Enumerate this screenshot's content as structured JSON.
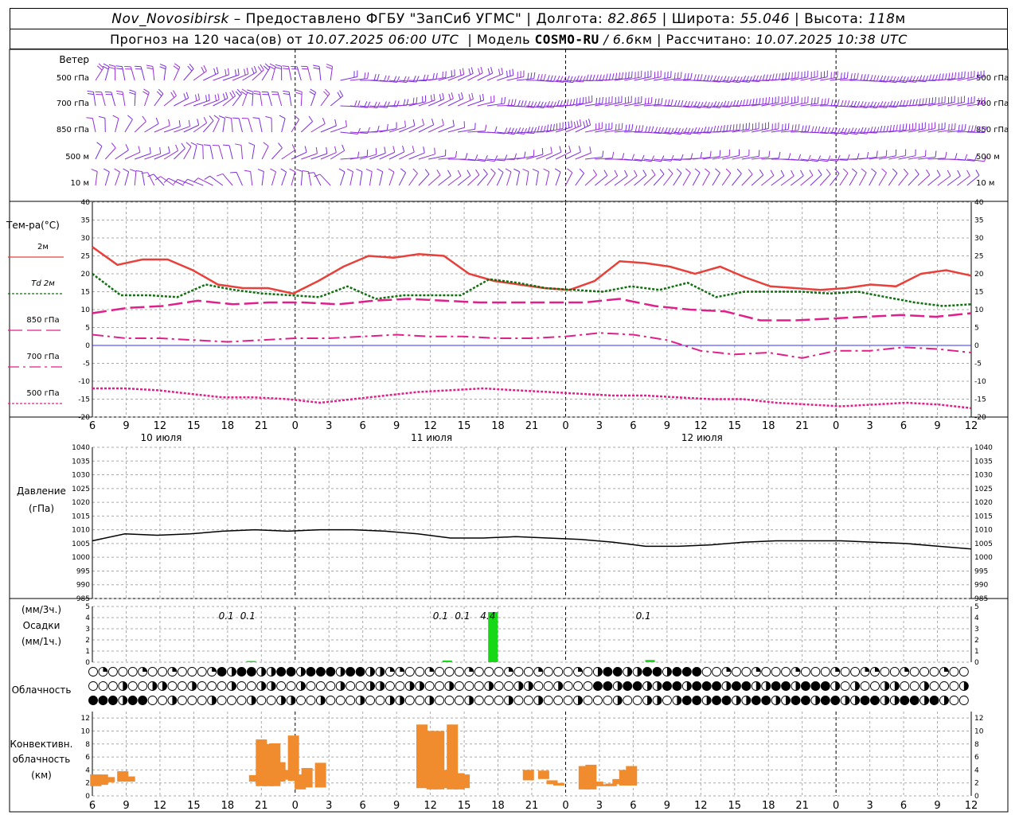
{
  "header": {
    "station": "Nov_Novosibirsk",
    "provided_by": "– Предоставлено ФГБУ \"ЗапСиб УГМС\"",
    "lon_label": "Долгота:",
    "lon_value": "82.865",
    "lat_label": "Широта:",
    "lat_value": "55.046",
    "alt_label": "Высота:",
    "alt_value": "118",
    "alt_unit": "м",
    "forecast_prefix": "Прогноз на 120 часа(ов) от",
    "forecast_time": "10.07.2025 06:00 UTC",
    "model_label": "Модель",
    "model_name": "COSMO-RU",
    "model_res": "/ 6.6",
    "model_res_unit": "км",
    "calc_label": "Рассчитано:",
    "calc_time": "10.07.2025 10:38 UTC",
    "sep": "|"
  },
  "chart_data": [
    {
      "type": "wind-barbs",
      "title": "Ветер",
      "levels": [
        "500 гПа",
        "700 гПа",
        "850 гПа",
        "500 м",
        "10  м"
      ],
      "colors": [
        "#9a30d8",
        "#7a2ee0"
      ]
    },
    {
      "type": "line",
      "title": "Тем-ра(°С)",
      "ylim": [
        -20,
        40
      ],
      "yticks": [
        40,
        35,
        30,
        25,
        20,
        15,
        10,
        5,
        0,
        -5,
        -10,
        -15,
        -20
      ],
      "x_hours": [
        6,
        9,
        12,
        15,
        18,
        21,
        0,
        3,
        6,
        9,
        12,
        15,
        18,
        21,
        0,
        3,
        6,
        9,
        12,
        15,
        18,
        21,
        0,
        3,
        6,
        9,
        12
      ],
      "day_labels": [
        "10 июля",
        "11 июля",
        "12 июля"
      ],
      "zero_line_color": "#3030ff",
      "series": [
        {
          "name": "2м",
          "color": "#e8403a",
          "values": [
            27.5,
            22.5,
            24,
            24,
            21,
            17,
            16,
            16,
            14.5,
            18,
            22,
            25,
            24.5,
            25.5,
            25,
            20,
            18,
            17,
            16,
            15.5,
            18,
            23.5,
            23,
            22,
            20,
            22,
            19,
            16.5,
            16,
            15.5,
            16,
            17,
            16.5,
            20,
            21,
            19.5
          ]
        },
        {
          "name": "Td  2м",
          "color": "#107010",
          "values": [
            20,
            14,
            14,
            13.5,
            17,
            15.5,
            14.5,
            14,
            13.5,
            16.5,
            13,
            14,
            14,
            14,
            18.5,
            17.5,
            16,
            15.5,
            15,
            16.5,
            15.5,
            17.5,
            13.5,
            15,
            15,
            15,
            14.5,
            15,
            13.5,
            12,
            11,
            11.5
          ]
        },
        {
          "name": "850 гПа",
          "color": "#e0208a",
          "values": [
            9,
            10.5,
            11,
            12.5,
            11.5,
            12,
            12,
            11.5,
            12.5,
            13,
            12.5,
            12,
            12,
            12,
            12,
            13,
            11,
            10,
            9.5,
            7,
            7,
            7.5,
            8,
            8.5,
            8,
            9
          ]
        },
        {
          "name": "700 гПа",
          "color": "#e0208a",
          "values": [
            3,
            2,
            2,
            1.5,
            1,
            1.5,
            2,
            2,
            2.5,
            3,
            2.5,
            2.5,
            2,
            2,
            2.5,
            3.5,
            3,
            1.5,
            -1.5,
            -2.5,
            -2,
            -3.5,
            -1.5,
            -1.5,
            -0.5,
            -1,
            -2
          ]
        },
        {
          "name": "500 гПа",
          "color": "#e0208a",
          "values": [
            -12,
            -12,
            -12.5,
            -13.5,
            -14.5,
            -14.5,
            -15,
            -16,
            -15,
            -14,
            -13,
            -12.5,
            -12,
            -12.5,
            -13,
            -13.5,
            -14,
            -14,
            -14.5,
            -15,
            -15,
            -16,
            -16.5,
            -17,
            -16.5,
            -16,
            -16.5,
            -17.5
          ]
        }
      ]
    },
    {
      "type": "line",
      "title": "Давление",
      "unit": "(гПа)",
      "ylim": [
        985,
        1040
      ],
      "yticks": [
        1040,
        1035,
        1030,
        1025,
        1020,
        1015,
        1010,
        1005,
        1000,
        995,
        990,
        985
      ],
      "series": [
        {
          "name": "",
          "color": "#000000",
          "values": [
            1006,
            1008.5,
            1008,
            1008.5,
            1009.5,
            1010,
            1009.5,
            1010,
            1010,
            1009.5,
            1008.5,
            1007,
            1007,
            1007.5,
            1007,
            1006.5,
            1005.5,
            1004,
            1004,
            1004.5,
            1005.5,
            1006,
            1006,
            1006,
            1005.5,
            1005,
            1004,
            1003
          ]
        }
      ]
    },
    {
      "type": "bar",
      "title": "Осадки",
      "units": [
        "(мм/3ч.)",
        "(мм/1ч.)"
      ],
      "ylim": [
        0,
        5
      ],
      "yticks": [
        5,
        4,
        3,
        2,
        1,
        0
      ],
      "color": "#16d816",
      "bars": [
        {
          "hour_index": 4.7,
          "value": 0.1
        },
        {
          "hour_index": 10.5,
          "value": 0.15
        },
        {
          "hour_index": 11.85,
          "value": 4.5
        },
        {
          "hour_index": 16.5,
          "value": 0.2
        }
      ],
      "labels": [
        {
          "hour_index": 3.96,
          "text": "0.1"
        },
        {
          "hour_index": 4.6,
          "text": "0.1"
        },
        {
          "hour_index": 10.3,
          "text": "0.1"
        },
        {
          "hour_index": 10.95,
          "text": "0.1"
        },
        {
          "hour_index": 11.7,
          "text": "4.4"
        },
        {
          "hour_index": 16.3,
          "text": "0.1"
        }
      ]
    },
    {
      "type": "symbols",
      "title": "Облачность"
    },
    {
      "type": "bar",
      "title": "Конвективн. облачность (км)",
      "ylim": [
        0,
        13
      ],
      "yticks": [
        12,
        10,
        8,
        6,
        4,
        2,
        0
      ],
      "color": "#f08c2e",
      "ranges": [
        [
          0.1,
          1.5,
          3.3
        ],
        [
          0.3,
          1.7,
          3.3
        ],
        [
          0.5,
          2.1,
          2.9
        ],
        [
          0.9,
          2.2,
          3.8
        ],
        [
          1.1,
          2.2,
          3.0
        ],
        [
          4.8,
          2.2,
          3.2
        ],
        [
          5.0,
          1.5,
          8.7
        ],
        [
          5.2,
          1.5,
          8.0
        ],
        [
          5.4,
          1.5,
          8.1
        ],
        [
          5.55,
          2.2,
          5.2
        ],
        [
          5.75,
          2.5,
          4.0
        ],
        [
          5.95,
          2.3,
          9.3
        ],
        [
          6.15,
          1.0,
          3.3
        ],
        [
          6.35,
          1.3,
          4.3
        ],
        [
          6.75,
          1.3,
          5.1
        ],
        [
          9.75,
          1.2,
          11.0
        ],
        [
          10.05,
          1.0,
          10.0
        ],
        [
          10.25,
          1.0,
          10.0
        ],
        [
          10.45,
          1.2,
          4.0
        ],
        [
          10.65,
          1.0,
          11.0
        ],
        [
          10.85,
          1.0,
          3.5
        ],
        [
          11.0,
          1.2,
          3.3
        ],
        [
          12.9,
          2.4,
          4.0
        ],
        [
          13.35,
          2.6,
          3.9
        ],
        [
          13.6,
          1.8,
          2.4
        ],
        [
          13.8,
          1.6,
          2.0
        ],
        [
          14.55,
          1.0,
          4.6
        ],
        [
          14.75,
          1.0,
          4.8
        ],
        [
          14.95,
          1.5,
          2.2
        ],
        [
          15.15,
          1.5,
          1.8
        ],
        [
          15.35,
          1.5,
          1.9
        ],
        [
          15.55,
          1.8,
          2.6
        ],
        [
          15.75,
          1.6,
          4.0
        ],
        [
          15.95,
          1.6,
          4.6
        ]
      ]
    }
  ]
}
